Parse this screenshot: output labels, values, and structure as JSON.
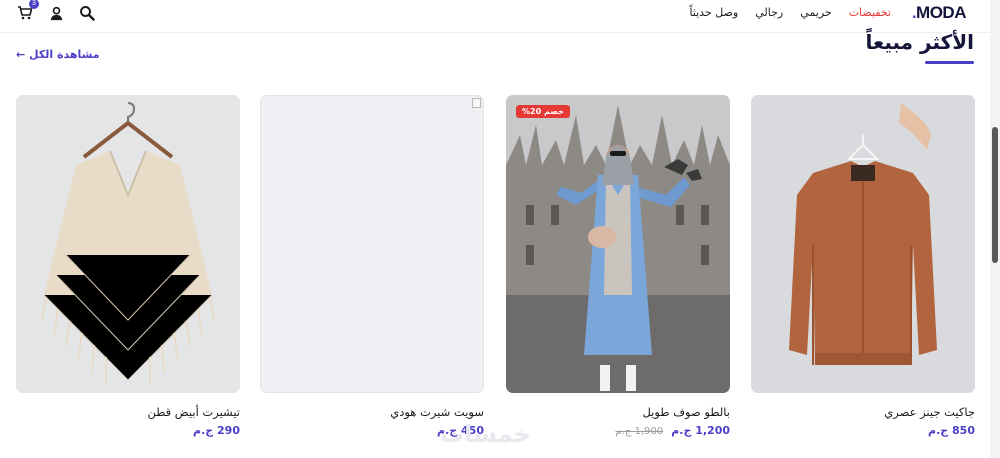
{
  "header": {
    "logo": "MODA",
    "logo_dot": ".",
    "nav": [
      {
        "label": "وصل حديثاً"
      },
      {
        "label": "رجالي"
      },
      {
        "label": "حريمي"
      },
      {
        "label": "تخفيضات"
      }
    ],
    "cart_count": "3",
    "icons": [
      "cart-icon",
      "user-icon",
      "search-icon"
    ]
  },
  "section": {
    "title": "الأكثر مبيعاً",
    "view_all": "مشاهدة الكل ←"
  },
  "products": [
    {
      "name": "جاكيت جينز عصري",
      "price": "850 ج.م",
      "old_price": "",
      "discount": ""
    },
    {
      "name": "بالطو صوف طويل",
      "price": "1,200 ج.م",
      "old_price": "1,900 ج.م",
      "discount": "خصم 20%"
    },
    {
      "name": "سويت شيرت هودي",
      "price": "450 ج.م",
      "old_price": "",
      "discount": ""
    },
    {
      "name": "تيشيرت أبيض قطن",
      "price": "290 ج.م",
      "old_price": "",
      "discount": ""
    }
  ],
  "watermark": "خمسات",
  "colors": {
    "accent": "#4b3fc8",
    "sale": "#e53935",
    "dark": "#14143a"
  }
}
